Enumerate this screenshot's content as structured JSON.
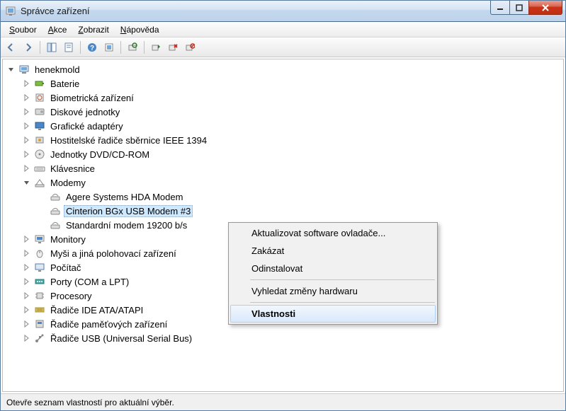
{
  "window": {
    "title": "Správce zařízení"
  },
  "menu": {
    "file": "Soubor",
    "action": "Akce",
    "view": "Zobrazit",
    "help": "Nápověda"
  },
  "tree": {
    "root": "henekmold",
    "categories": [
      {
        "label": "Baterie",
        "icon": "battery"
      },
      {
        "label": "Biometrická zařízení",
        "icon": "biometric"
      },
      {
        "label": "Diskové jednotky",
        "icon": "disk"
      },
      {
        "label": "Grafické adaptéry",
        "icon": "display"
      },
      {
        "label": "Hostitelské řadiče sběrnice IEEE 1394",
        "icon": "firewire"
      },
      {
        "label": "Jednotky DVD/CD-ROM",
        "icon": "cdrom"
      },
      {
        "label": "Klávesnice",
        "icon": "keyboard"
      },
      {
        "label": "Modemy",
        "icon": "modem",
        "expanded": true,
        "children": [
          {
            "label": "Agere Systems HDA Modem"
          },
          {
            "label": "Cinterion BGx USB Modem #3",
            "selected": true
          },
          {
            "label": "Standardní modem 19200 b/s"
          }
        ]
      },
      {
        "label": "Monitory",
        "icon": "monitor"
      },
      {
        "label": "Myši a jiná polohovací zařízení",
        "icon": "mouse"
      },
      {
        "label": "Počítač",
        "icon": "computer"
      },
      {
        "label": "Porty (COM a LPT)",
        "icon": "port"
      },
      {
        "label": "Procesory",
        "icon": "cpu"
      },
      {
        "label": "Řadiče IDE ATA/ATAPI",
        "icon": "ide"
      },
      {
        "label": "Řadiče paměťových zařízení",
        "icon": "storage"
      },
      {
        "label": "Řadiče USB (Universal Serial Bus)",
        "icon": "usb"
      }
    ]
  },
  "context_menu": {
    "update_driver": "Aktualizovat software ovladače...",
    "disable": "Zakázat",
    "uninstall": "Odinstalovat",
    "scan": "Vyhledat změny hardwaru",
    "properties": "Vlastnosti"
  },
  "statusbar": {
    "text": "Otevře seznam vlastností pro aktuální výběr."
  }
}
